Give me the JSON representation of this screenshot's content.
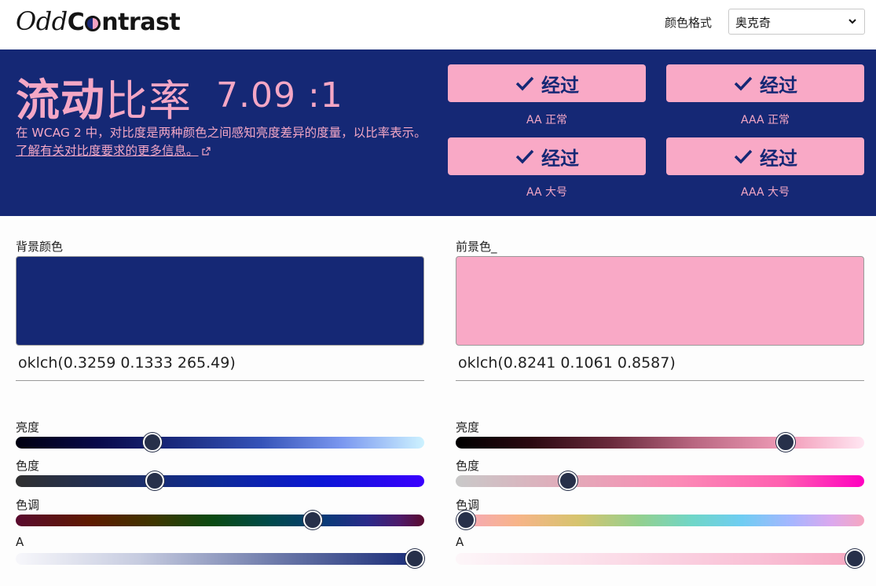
{
  "app": {
    "logo_part1": "Odd",
    "logo_part2_a": "C",
    "logo_part2_b": "ntrast"
  },
  "format": {
    "label": "颜色格式",
    "selected": "奥克奇"
  },
  "hero": {
    "title_bold": "流动",
    "title_light": "比率",
    "ratio": "7.09 :1",
    "desc_text": "在 WCAG 2 中，对比度是两种颜色之间感知亮度差异的度量，以比率表示。",
    "desc_link": "了解有关对比度要求的更多信息。",
    "checks": [
      {
        "result": "经过",
        "label": "AA 正常"
      },
      {
        "result": "经过",
        "label": "AAA 正常"
      },
      {
        "result": "经过",
        "label": "AA 大号"
      },
      {
        "result": "经过",
        "label": "AAA 大号"
      }
    ]
  },
  "background": {
    "label": "背景颜色",
    "value": "oklch(0.3259 0.1333 265.49)",
    "swatch_color": "#152875",
    "sliders": {
      "lightness_label": "亮度",
      "chroma_label": "色度",
      "hue_label": "色调",
      "alpha_label": "A",
      "lightness": 0.3259,
      "chroma": 0.1333,
      "hue": 265.49,
      "alpha": 1
    }
  },
  "foreground": {
    "label": "前景色_",
    "value": "oklch(0.8241 0.1061 0.8587)",
    "swatch_color": "#f9a9c6",
    "sliders": {
      "lightness_label": "亮度",
      "chroma_label": "色度",
      "hue_label": "色调",
      "alpha_label": "A",
      "lightness": 0.8241,
      "chroma": 0.1061,
      "hue": 0.8587,
      "alpha": 1
    }
  },
  "colors": {
    "hero_bg": "#152875",
    "accent_pink": "#f4a7c5",
    "thumb": "#27304a"
  }
}
